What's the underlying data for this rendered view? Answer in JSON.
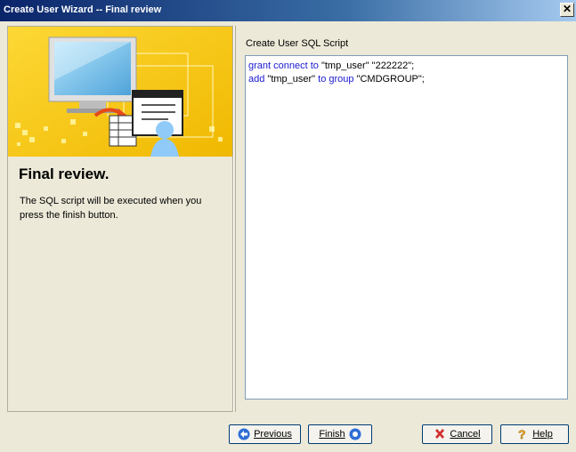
{
  "window": {
    "title": "Create User Wizard -- Final review",
    "close_glyph": "✕"
  },
  "left_panel": {
    "heading": "Final review.",
    "description": "The SQL script will be executed when you press the finish button."
  },
  "right_panel": {
    "label": "Create User SQL Script",
    "script_lines": [
      [
        {
          "text": "grant connect to",
          "kw": true
        },
        {
          "text": " \"tmp_user\" \"222222\";",
          "kw": false
        }
      ],
      [
        {
          "text": "add",
          "kw": true
        },
        {
          "text": " \"tmp_user\" ",
          "kw": false
        },
        {
          "text": "to group",
          "kw": true
        },
        {
          "text": " \"CMDGROUP\";",
          "kw": false
        }
      ]
    ]
  },
  "buttons": {
    "previous": "Previous",
    "finish": "Finish",
    "cancel": "Cancel",
    "help": "Help"
  },
  "icons": {
    "previous": "left-arrow-icon",
    "finish": "finish-icon",
    "cancel": "red-x-icon",
    "help": "question-icon"
  },
  "colors": {
    "keyword": "#1a1ad0",
    "banner_bg": "#f5c400",
    "titlebar": "#0a246a"
  }
}
